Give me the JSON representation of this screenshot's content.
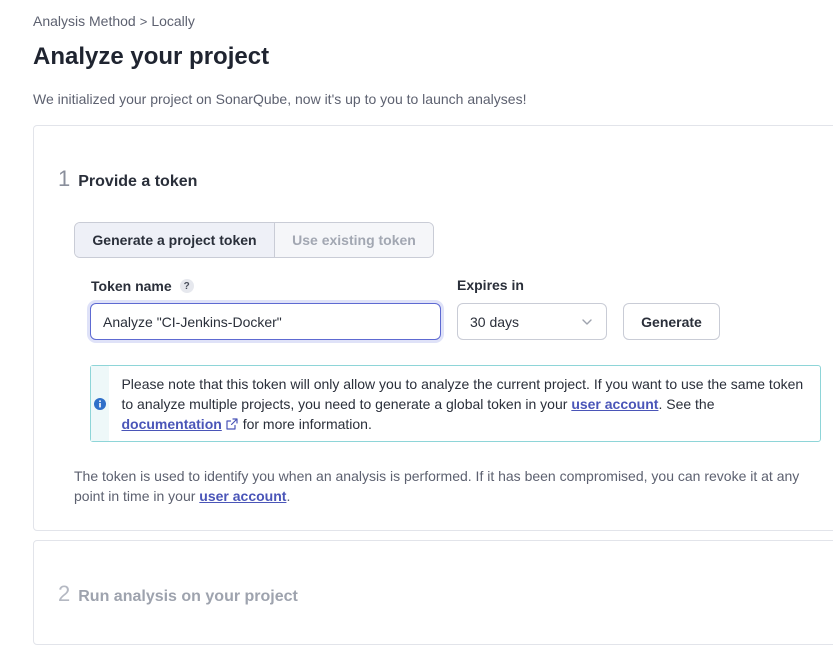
{
  "breadcrumb": {
    "parent": "Analysis Method",
    "separator": ">",
    "current": "Locally"
  },
  "page": {
    "title": "Analyze your project",
    "intro": "We initialized your project on SonarQube, now it's up to you to launch analyses!"
  },
  "step1": {
    "number": "1",
    "title": "Provide a token",
    "toggle": {
      "generate": "Generate a project token",
      "existing": "Use existing token"
    },
    "token_label": "Token name",
    "help_glyph": "?",
    "token_value": "Analyze \"CI-Jenkins-Docker\"",
    "expires_label": "Expires in",
    "expires_value": "30 days",
    "generate_label": "Generate",
    "note": {
      "part1": "Please note that this token will only allow you to analyze the current project. If you want to use the same token to analyze multiple projects, you need to generate a global token in your ",
      "link1": "user account",
      "part2": ". See the ",
      "link2": "documentation",
      "part3": " for more information."
    },
    "footnote": {
      "text": "The token is used to identify you when an analysis is performed. If it has been compromised, you can revoke it at any point in time in your ",
      "link": "user account",
      "end": "."
    }
  },
  "step2": {
    "number": "2",
    "title": "Run analysis on your project"
  },
  "colors": {
    "accent": "#5e6ad2",
    "link": "#4a55b8",
    "info_border": "#8ed5d8",
    "info_icon": "#2f6fc9"
  },
  "icons": {
    "info": "info-icon",
    "help": "help-icon",
    "chevron": "chevron-down-icon",
    "external": "external-link-icon"
  }
}
